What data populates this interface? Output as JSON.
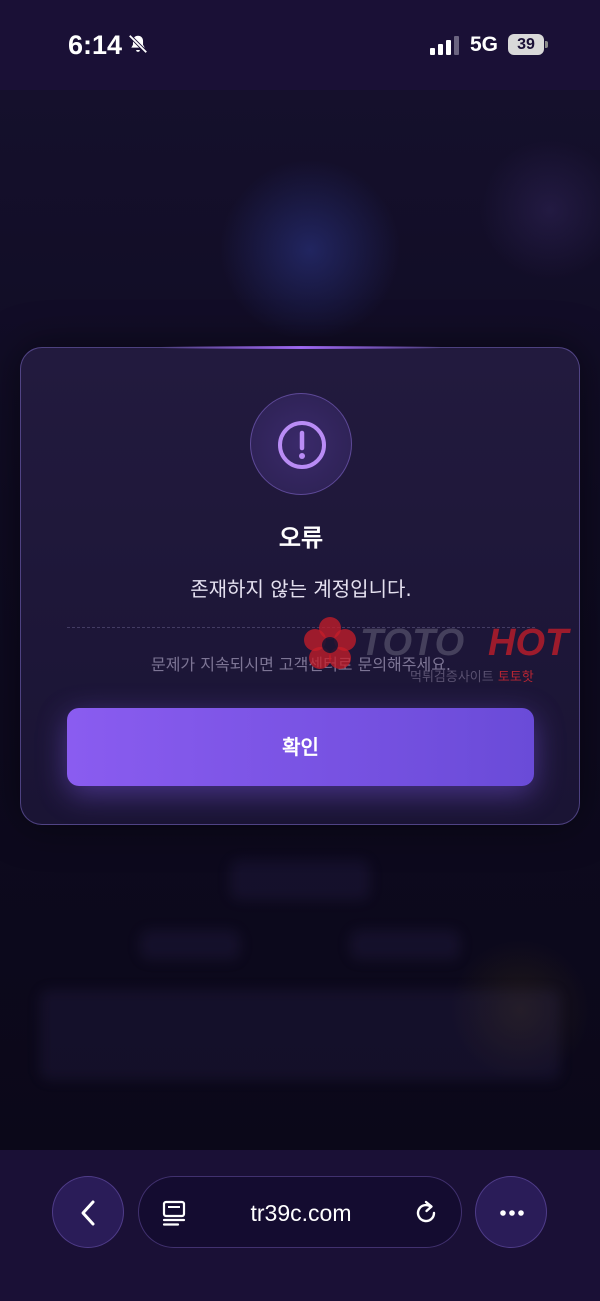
{
  "status_bar": {
    "time": "6:14",
    "network": "5G",
    "battery": "39"
  },
  "dialog": {
    "title": "오류",
    "message": "존재하지 않는 계정입니다.",
    "sub_message": "문제가 지속되시면 고객센터로 문의해주세요.",
    "confirm_label": "확인",
    "accent_color": "#7c55e6"
  },
  "watermark": {
    "brand_left": "TOTO",
    "brand_right": "HOT",
    "tagline_prefix": "먹튀검증사이트",
    "tagline_brand": "토토핫"
  },
  "browser": {
    "url": "tr39c.com"
  }
}
